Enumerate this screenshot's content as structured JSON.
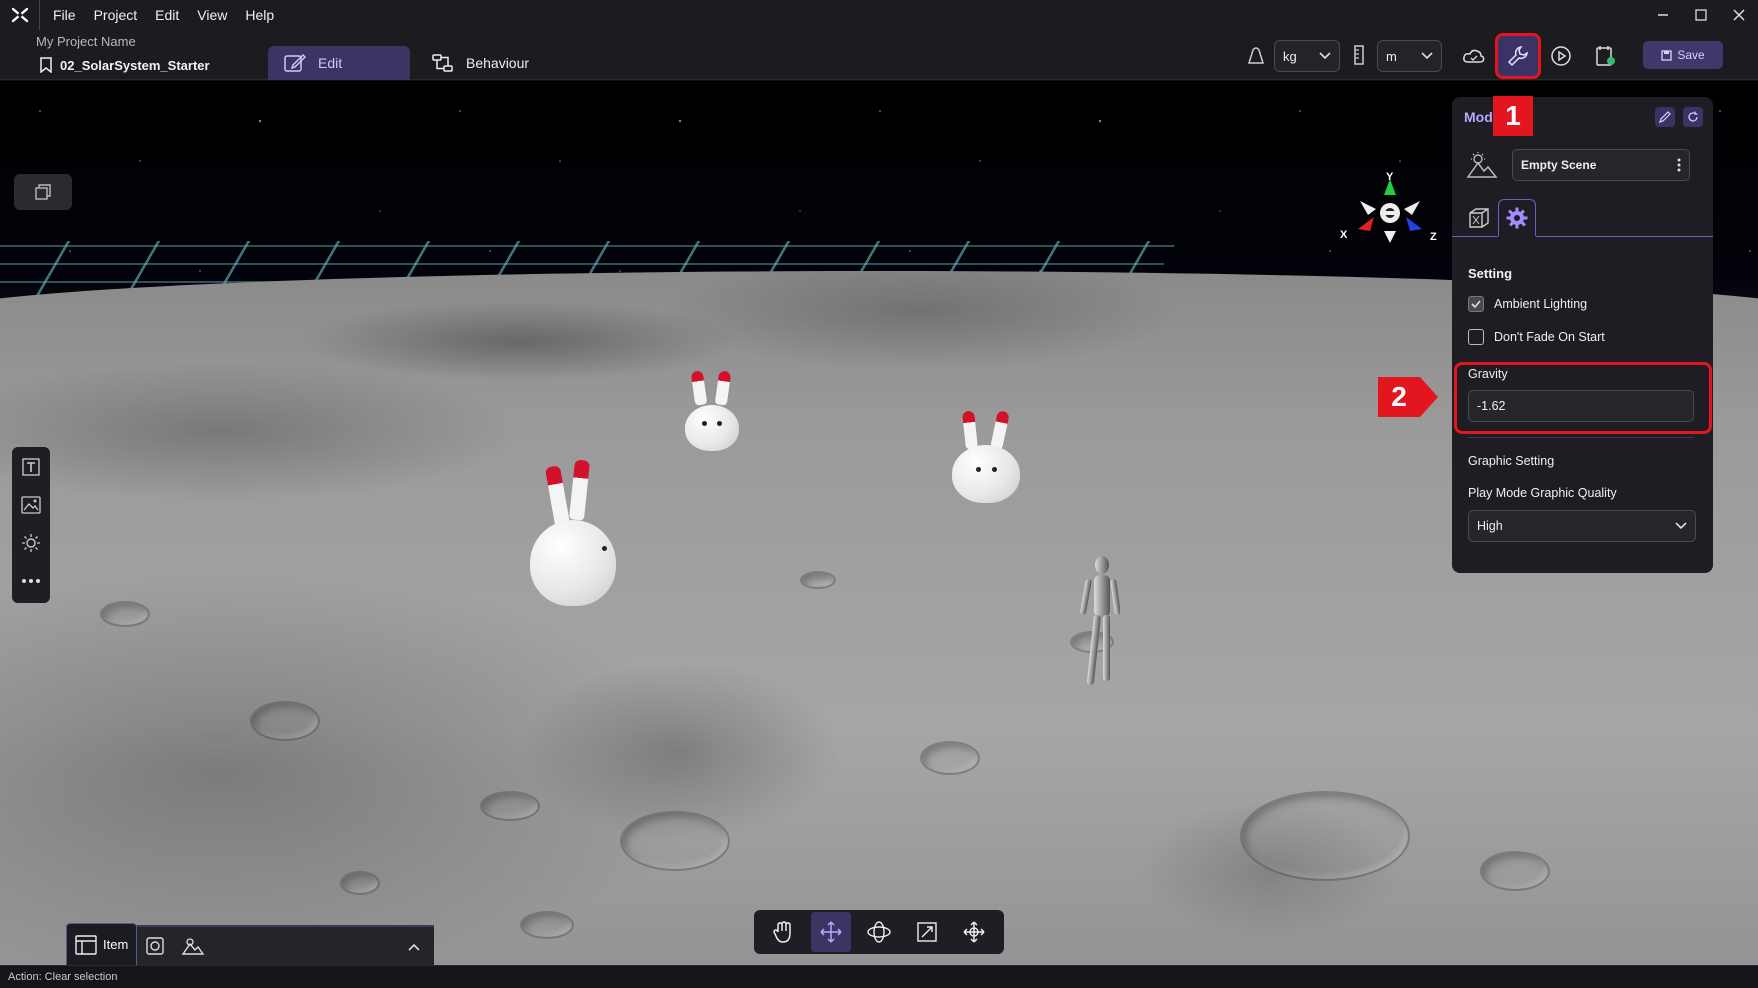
{
  "menubar": {
    "items": [
      "File",
      "Project",
      "Edit",
      "View",
      "Help"
    ],
    "window_controls": [
      "minimize-icon",
      "maximize-icon",
      "close-icon"
    ]
  },
  "toolbar": {
    "project_name": "My Project Name",
    "scene_file": "02_SolarSystem_Starter",
    "tab_edit": "Edit",
    "tab_behaviour": "Behaviour",
    "mass_unit": "kg",
    "length_unit": "m",
    "save_label": "Save"
  },
  "panel": {
    "title": "Mod",
    "scene_select": "Empty Scene",
    "setting_title": "Setting",
    "ambient_lighting_label": "Ambient Lighting",
    "ambient_lighting_checked": true,
    "dont_fade_label": "Don't Fade On Start",
    "dont_fade_checked": false,
    "gravity_label": "Gravity",
    "gravity_value": "-1.62",
    "graphic_setting_title": "Graphic Setting",
    "quality_label": "Play Mode Graphic Quality",
    "quality_value": "High"
  },
  "gizmo": {
    "x": "X",
    "y": "Y",
    "z": "Z"
  },
  "annotations": {
    "badge_1": "1",
    "badge_2": "2",
    "color": "#e3161f"
  },
  "bottom_tabs": {
    "item_label": "Item"
  },
  "status": {
    "text": "Action: Clear selection"
  },
  "colors": {
    "accent": "#3d3463",
    "accent_text": "#b9a9ff",
    "panel_bg": "#1d1d23"
  }
}
